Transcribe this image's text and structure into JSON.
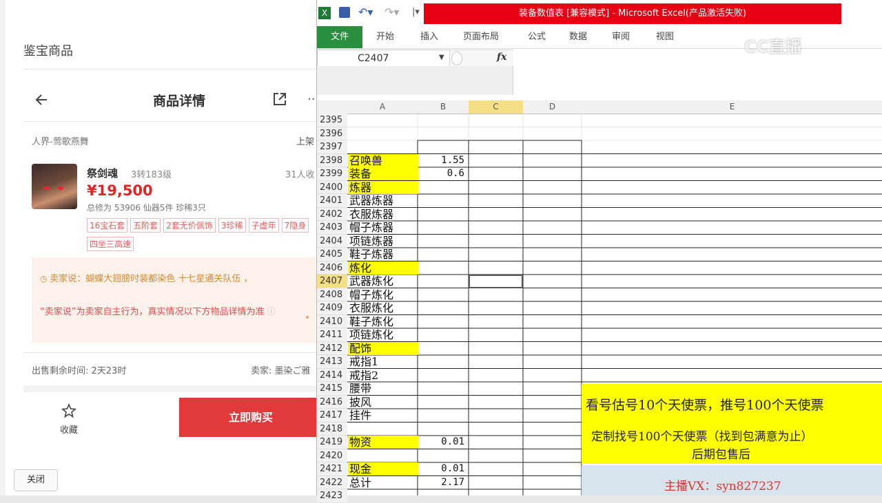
{
  "shop": {
    "header_title": "鉴宝商品",
    "detail_title": "商品详情",
    "more_label": "···",
    "server": "人界-莺歌燕舞",
    "server_right": "上架",
    "char_name": "祭剑魂",
    "char_level": "3转183级",
    "price": "¥19,500",
    "watchers": "31人收",
    "stats": "总修为 53906  仙器5件  珍稀3只",
    "tags": [
      "16宝石套",
      "五阶套",
      "2套无价佩饰",
      "3珍稀",
      "子虚年",
      "7隐身",
      "四坐三高速"
    ],
    "seller_says": "卖家说：蝴蝶大翅膀时装都染色 十七星通关队伍 ，",
    "disclaimer": "“卖家说”为卖家自主行为，真实情况以下方物品详情为准",
    "time_left": "出售剩余时间: 2天23时",
    "seller": "卖家: 墨染ご雅",
    "fav_label": "收藏",
    "buy_label": "立即购买",
    "close_label": "关闭"
  },
  "excel": {
    "title": "装备数值表  [兼容模式]  -  Microsoft Excel(产品激活失败)",
    "tabs": [
      "文件",
      "开始",
      "插入",
      "页面布局",
      "公式",
      "数据",
      "审阅",
      "视图"
    ],
    "namebox": "C2407",
    "fx": "fx",
    "columns": [
      "A",
      "B",
      "C",
      "D",
      "E"
    ],
    "rows": [
      {
        "n": "2395",
        "a": "",
        "b": "",
        "hl": false
      },
      {
        "n": "2396",
        "a": "",
        "b": "",
        "hl": false
      },
      {
        "n": "2397",
        "a": "",
        "b": "",
        "hl": false
      },
      {
        "n": "2398",
        "a": "召唤兽",
        "b": "1.55",
        "hl": true
      },
      {
        "n": "2399",
        "a": "装备",
        "b": "0.6",
        "hl": true
      },
      {
        "n": "2400",
        "a": "炼器",
        "b": "",
        "hl": true
      },
      {
        "n": "2401",
        "a": "武器炼器",
        "b": "",
        "hl": false
      },
      {
        "n": "2402",
        "a": "衣服炼器",
        "b": "",
        "hl": false
      },
      {
        "n": "2403",
        "a": "帽子炼器",
        "b": "",
        "hl": false
      },
      {
        "n": "2404",
        "a": "项链炼器",
        "b": "",
        "hl": false
      },
      {
        "n": "2405",
        "a": "鞋子炼器",
        "b": "",
        "hl": false
      },
      {
        "n": "2406",
        "a": "炼化",
        "b": "",
        "hl": true
      },
      {
        "n": "2407",
        "a": "武器炼化",
        "b": "",
        "hl": false
      },
      {
        "n": "2408",
        "a": "帽子炼化",
        "b": "",
        "hl": false
      },
      {
        "n": "2409",
        "a": "衣服炼化",
        "b": "",
        "hl": false
      },
      {
        "n": "2410",
        "a": "鞋子炼化",
        "b": "",
        "hl": false
      },
      {
        "n": "2411",
        "a": "项链炼化",
        "b": "",
        "hl": false
      },
      {
        "n": "2412",
        "a": "配饰",
        "b": "",
        "hl": true
      },
      {
        "n": "2413",
        "a": "戒指1",
        "b": "",
        "hl": false
      },
      {
        "n": "2414",
        "a": "戒指2",
        "b": "",
        "hl": false
      },
      {
        "n": "2415",
        "a": "腰带",
        "b": "",
        "hl": false
      },
      {
        "n": "2416",
        "a": "披风",
        "b": "",
        "hl": false
      },
      {
        "n": "2417",
        "a": "挂件",
        "b": "",
        "hl": false
      },
      {
        "n": "2418",
        "a": "",
        "b": "",
        "hl": false
      },
      {
        "n": "2419",
        "a": "物资",
        "b": "0.01",
        "hl": true
      },
      {
        "n": "2420",
        "a": "",
        "b": "",
        "hl": false
      },
      {
        "n": "2421",
        "a": "现金",
        "b": "0.01",
        "hl": true
      },
      {
        "n": "2422",
        "a": "总计",
        "b": "2.17",
        "hl": false
      },
      {
        "n": "2423",
        "a": "",
        "b": "",
        "hl": false
      }
    ],
    "ad_line1": "看号估号10个天使票，推号100个天使票",
    "ad_line2": "定制找号100个天使票（找到包满意为止）",
    "ad_line3": "后期包售后",
    "ad_contact": "主播VX：syn827237",
    "watermark": "CC直播",
    "highlight_color": "#ffff00",
    "active_row": "2407"
  }
}
